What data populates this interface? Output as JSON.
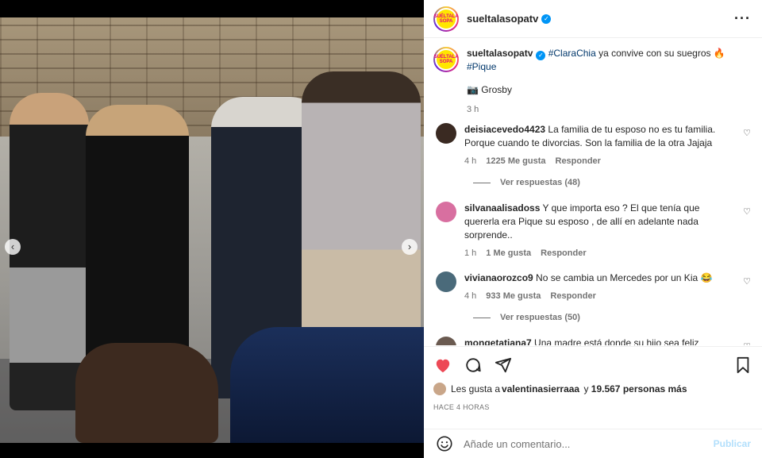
{
  "post": {
    "username": "sueltalasopatv",
    "avatar_text": "SUÉLTALA SOPA",
    "caption_hashtag_1": "#ClaraChia",
    "caption_text": " ya convive con su suegros 🔥",
    "caption_hashtag_2": "#Pique",
    "credit": "📷 Grosby",
    "time": "3 h",
    "carousel_dots": 5,
    "active_dot": 0
  },
  "comments": [
    {
      "user": "deisiacevedo4423",
      "text": "La familia de tu esposo no es tu familia. Porque cuando te divorcias. Son la familia de la otra Jajaja",
      "time": "4 h",
      "likes": "1225 Me gusta",
      "reply": "Responder",
      "avatar_color": "#3a2a22",
      "view_replies": "Ver respuestas (48)"
    },
    {
      "user": "silvanaalisadoss",
      "text": "Y que importa eso ? El que tenía que quererla era Pique su esposo , de allí en adelante nada sorprende..",
      "time": "1 h",
      "likes": "1 Me gusta",
      "reply": "Responder",
      "avatar_color": "#d86fa0",
      "view_replies": ""
    },
    {
      "user": "vivianaorozco9",
      "text": "No se cambia un Mercedes por un Kia 😂",
      "time": "4 h",
      "likes": "933 Me gusta",
      "reply": "Responder",
      "avatar_color": "#4a6a7a",
      "view_replies": "Ver respuestas (50)"
    },
    {
      "user": "mongetatiana7",
      "text": "Una madre está donde su hijo sea feliz",
      "time": "",
      "likes": "",
      "reply": "",
      "avatar_color": "#6a5a50",
      "view_replies": ""
    }
  ],
  "actions": {
    "liked_by_prefix": "Les gusta a ",
    "liked_by_user": "valentinasierraaa",
    "liked_by_suffix": " y ",
    "liked_by_count": "19.567 personas más",
    "ago": "HACE 4 HORAS"
  },
  "add_comment": {
    "placeholder": "Añade un comentario...",
    "publish": "Publicar"
  },
  "colors": {
    "like_red": "#ed4956",
    "link_blue": "#00376b",
    "verified_blue": "#0095f6",
    "publish_disabled": "#b2dffc"
  },
  "icons": {
    "like": "heart-icon",
    "comment": "comment-bubble-icon",
    "share": "paper-plane-icon",
    "save": "bookmark-icon",
    "emoji": "smiley-icon",
    "more": "more-options-icon"
  }
}
